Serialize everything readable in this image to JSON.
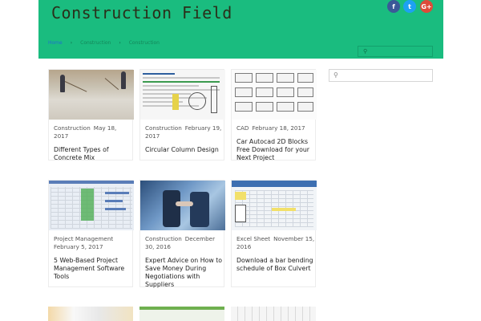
{
  "site": {
    "title": "Construction Field"
  },
  "social": {
    "facebook": "f",
    "twitter": "t",
    "googleplus": "G+"
  },
  "nav": {
    "items": [
      {
        "label": "Home"
      },
      {
        "label": "Construction"
      },
      {
        "label": "Construction"
      }
    ],
    "separator": "›"
  },
  "header_search": {
    "placeholder": ""
  },
  "side_search": {
    "placeholder": ""
  },
  "icons": {
    "search": "search-icon"
  },
  "colors": {
    "header_bg": "#1abc7f",
    "accent": "#1f6fd0"
  },
  "posts": [
    {
      "category": "Construction",
      "date": "May 18, 2017",
      "title": "Different Types of Concrete Mix"
    },
    {
      "category": "Construction",
      "date": "February 19, 2017",
      "title": "Circular Column Design"
    },
    {
      "category": "CAD",
      "date": "February 18, 2017",
      "title": "Car Autocad 2D Blocks Free Download for your Next Project"
    },
    {
      "category": "Project Management",
      "date": "February 5, 2017",
      "title": "5 Web-Based Project Management Software Tools"
    },
    {
      "category": "Construction",
      "date": "December 30, 2016",
      "title": "Expert Advice on How to Save Money During Negotiations with Suppliers"
    },
    {
      "category": "Excel Sheet",
      "date": "November 15, 2016",
      "title": "Download a bar bending schedule of Box Culvert"
    }
  ]
}
